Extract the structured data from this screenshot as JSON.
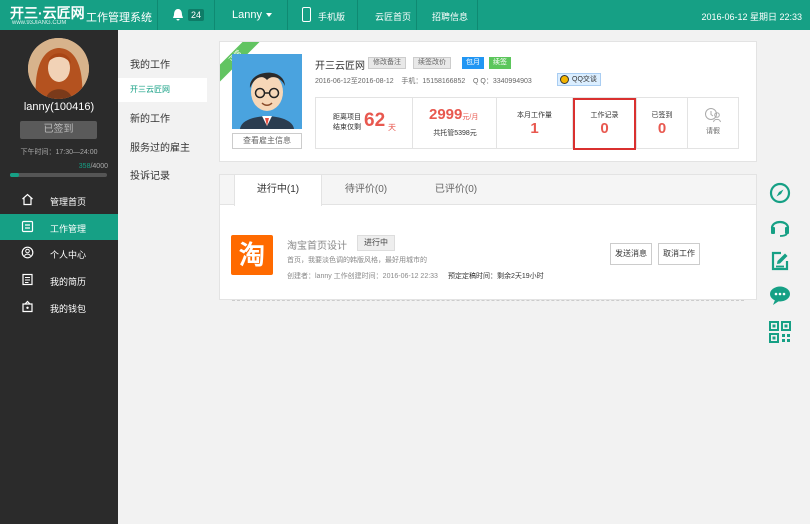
{
  "header": {
    "logo_main": "开三·云匠网",
    "logo_sub": "www.93JIANG.COM",
    "system_name": "工作管理系统",
    "notifications": "24",
    "user": "Lanny",
    "mobile": "手机版",
    "links": [
      "云匠首页",
      "招聘信息"
    ],
    "datetime": "2016-06-12 星期日 22:33",
    "accent": "#16a085"
  },
  "sidebar": {
    "username": "lanny(100416)",
    "sign_btn": "已签到",
    "work_time": "下午时间：17:30—24:00",
    "progress_current": "358",
    "progress_total": "/4000",
    "progress_fraction": 0.0895,
    "items": [
      {
        "label": "管理首页",
        "icon": "home-icon"
      },
      {
        "label": "工作管理",
        "icon": "briefcase-icon"
      },
      {
        "label": "个人中心",
        "icon": "user-icon"
      },
      {
        "label": "我的简历",
        "icon": "resume-icon"
      },
      {
        "label": "我的钱包",
        "icon": "wallet-icon"
      }
    ]
  },
  "subnav": [
    "我的工作",
    "开三云匠网",
    "新的工作",
    "服务过的雇主",
    "投诉记录"
  ],
  "employer": {
    "ribbon": "正常",
    "view_btn": "查看雇主信息",
    "name": "开三云匠网",
    "tags": [
      "修改备注",
      "续签改价",
      "包月",
      "续签"
    ],
    "period": "2016-06-12至2016-08-12",
    "phone": "手机：15158166852",
    "qq": "Q Q：3340994903",
    "qq_btn": "QQ交谈",
    "stats": {
      "remain_label_1": "距离项目",
      "remain_label_2": "结束仅剩",
      "remain_days": "62",
      "remain_unit": "天",
      "price": "2999",
      "price_unit": "元/月",
      "total": "共托管5398元",
      "monthly_label": "本月工作量",
      "monthly_value": "1",
      "records_label": "工作记录",
      "records_value": "0",
      "signed_label": "已签到",
      "signed_value": "0",
      "leave_label": "请假"
    }
  },
  "tabs": [
    "进行中(1)",
    "待评价(0)",
    "已评价(0)"
  ],
  "job": {
    "logo_char": "淘",
    "title": "淘宝首页设计",
    "status": "进行中",
    "desc": "首页，我要淡色调的韩版风格，最好用城市的",
    "created": "创建者：lanny 工作创建时间：2016-06-12 22:33",
    "deadline": "预定定稿时间：剩余2天19小时",
    "send_btn": "发送消息",
    "cancel_btn": "取消工作"
  },
  "right_icons": [
    "compass-icon",
    "headset-icon",
    "edit-icon",
    "chat-icon",
    "qrcode-icon"
  ]
}
